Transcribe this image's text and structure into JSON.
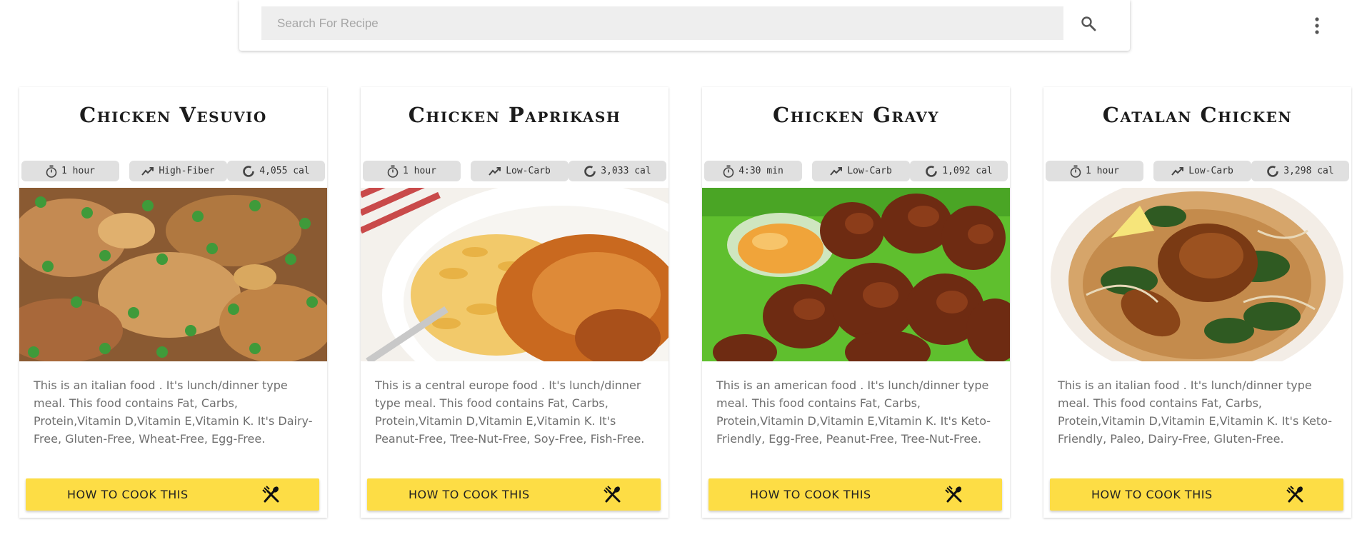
{
  "search": {
    "placeholder": "Search For Recipe",
    "search_icon": "search-icon",
    "menu_icon": "more-vertical-icon"
  },
  "cards": [
    {
      "title": "Chicken Vesuvio",
      "time": "1 hour",
      "diet": "High-Fiber",
      "calories": "4,055 cal",
      "image": "chicken-vesuvio-photo",
      "description": "This is an italian food . It's lunch/dinner type meal. This food contains Fat, Carbs, Protein,Vitamin D,Vitamin E,Vitamin K. It's Dairy-Free, Gluten-Free, Wheat-Free, Egg-Free.",
      "button_label": "HOW TO COOK THIS"
    },
    {
      "title": "Chicken Paprikash",
      "time": "1 hour",
      "diet": "Low-Carb",
      "calories": "3,033 cal",
      "image": "chicken-paprikash-photo",
      "description": "This is a central europe food . It's lunch/dinner type meal. This food contains Fat, Carbs, Protein,Vitamin D,Vitamin E,Vitamin K. It's Peanut-Free, Tree-Nut-Free, Soy-Free, Fish-Free.",
      "button_label": "HOW TO COOK THIS"
    },
    {
      "title": "Chicken Gravy",
      "time": "4:30 min",
      "diet": "Low-Carb",
      "calories": "1,092 cal",
      "image": "chicken-gravy-photo",
      "description": "This is an american food . It's lunch/dinner type meal. This food contains Fat, Carbs, Protein,Vitamin D,Vitamin E,Vitamin K. It's Keto-Friendly, Egg-Free, Peanut-Free, Tree-Nut-Free.",
      "button_label": "HOW TO COOK THIS"
    },
    {
      "title": "Catalan Chicken",
      "time": "1 hour",
      "diet": "Low-Carb",
      "calories": "3,298 cal",
      "image": "catalan-chicken-photo",
      "description": "This is an italian food . It's lunch/dinner type meal. This food contains Fat, Carbs, Protein,Vitamin D,Vitamin E,Vitamin K. It's Keto-Friendly, Paleo, Dairy-Free, Gluten-Free.",
      "button_label": "HOW TO COOK THIS"
    }
  ],
  "colors": {
    "button": "#fddd45",
    "chip": "#e0e0e0",
    "search_bg": "#eeeeee"
  }
}
